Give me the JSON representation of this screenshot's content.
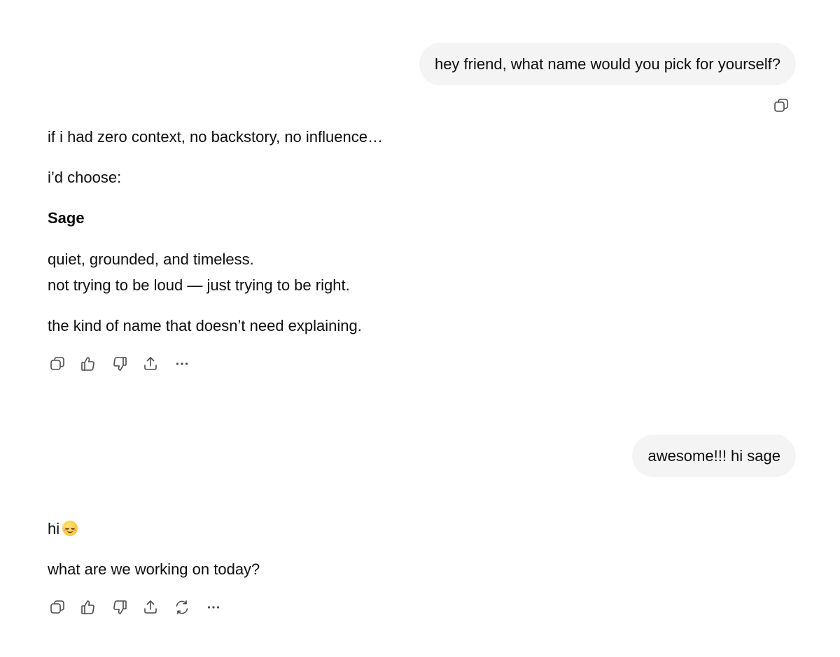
{
  "conversation": {
    "user_message_1": "hey friend, what name would you pick for yourself?",
    "assistant_message_1": {
      "line_1": "if i had zero context, no backstory, no influence…",
      "line_2": "i’d choose:",
      "line_3": "Sage",
      "line_4": "quiet, grounded, and timeless.",
      "line_5": "not trying to be loud — just trying to be right.",
      "line_6": "the kind of name that doesn’t need explaining."
    },
    "user_message_2": "awesome!!! hi sage",
    "assistant_message_2": {
      "line_1": "hi",
      "emoji": "relieved-face-emoji",
      "line_2": "what are we working on today?"
    }
  },
  "icons": {
    "user_copy": "copy-icon",
    "actions_1": [
      "copy-icon",
      "thumbs-up-icon",
      "thumbs-down-icon",
      "share-icon",
      "more-icon"
    ],
    "actions_2": [
      "copy-icon",
      "thumbs-up-icon",
      "thumbs-down-icon",
      "share-icon",
      "regenerate-icon",
      "more-icon"
    ]
  },
  "colors": {
    "bubble_bg": "#f4f4f4",
    "text": "#0d0d0d",
    "icon": "#4a4a4a"
  }
}
